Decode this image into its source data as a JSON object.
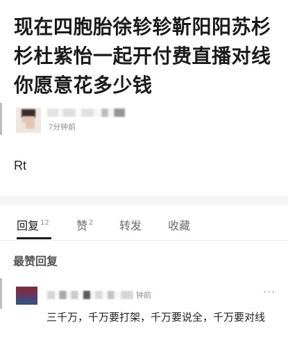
{
  "post": {
    "title": "现在四胞胎徐轸轸靳阳阳苏杉杉杜紫怡一起开付费直播对线你愿意花多少钱",
    "time": "7分钟前",
    "body": "Rt"
  },
  "tabs": [
    {
      "label": "回复",
      "count": "12"
    },
    {
      "label": "赞",
      "count": "2"
    },
    {
      "label": "转发",
      "count": ""
    },
    {
      "label": "收藏",
      "count": ""
    }
  ],
  "section_title": "最赞回复",
  "comment": {
    "time": "钟前",
    "more": "···",
    "text": "三千万，千万要打架，千万要说全，千万要对线"
  },
  "colors": {
    "accent": "#1a1a1a",
    "muted": "#8a8a8a",
    "band": "#f4f4f4"
  },
  "icons": {
    "more": "more-dots-icon"
  }
}
